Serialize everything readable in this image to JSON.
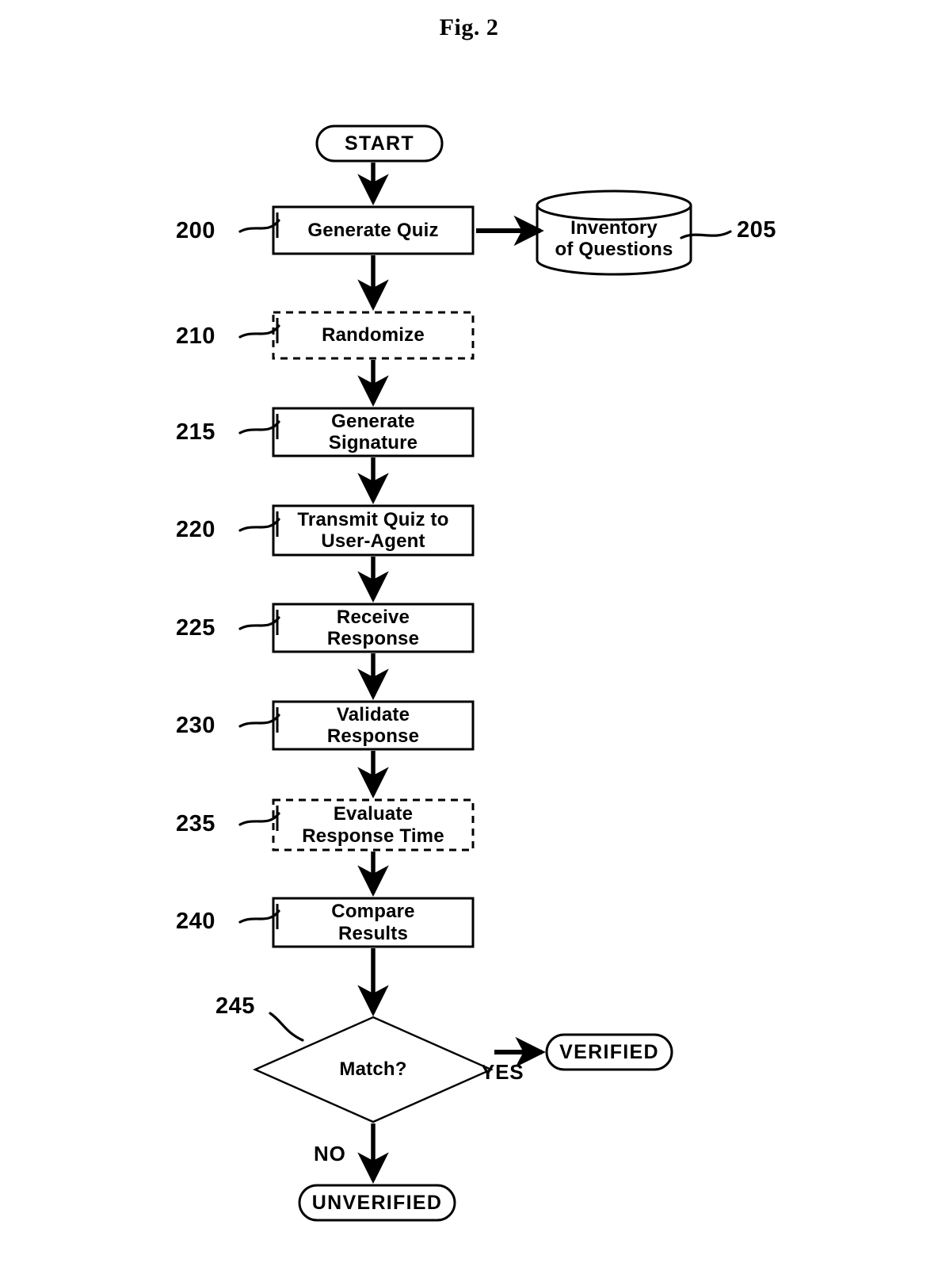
{
  "figure": {
    "title": "Fig. 2",
    "type": "flowchart",
    "description": "Patent flowchart for quiz-based user-agent verification"
  },
  "nodes": [
    {
      "id": "start",
      "kind": "terminator",
      "label": "START",
      "ref": null,
      "border": "solid"
    },
    {
      "id": "200",
      "kind": "process",
      "label": "Generate Quiz",
      "ref": "200",
      "border": "solid"
    },
    {
      "id": "205",
      "kind": "database",
      "label": "Inventory\nof Questions",
      "ref": "205",
      "border": "solid"
    },
    {
      "id": "210",
      "kind": "process",
      "label": "Randomize",
      "ref": "210",
      "border": "dashed"
    },
    {
      "id": "215",
      "kind": "process",
      "label": "Generate\nSignature",
      "ref": "215",
      "border": "solid"
    },
    {
      "id": "220",
      "kind": "process",
      "label": "Transmit Quiz to\nUser-Agent",
      "ref": "220",
      "border": "solid"
    },
    {
      "id": "225",
      "kind": "process",
      "label": "Receive\nResponse",
      "ref": "225",
      "border": "solid"
    },
    {
      "id": "230",
      "kind": "process",
      "label": "Validate\nResponse",
      "ref": "230",
      "border": "solid"
    },
    {
      "id": "235",
      "kind": "process",
      "label": "Evaluate\nResponse Time",
      "ref": "235",
      "border": "dashed"
    },
    {
      "id": "240",
      "kind": "process",
      "label": "Compare\nResults",
      "ref": "240",
      "border": "solid"
    },
    {
      "id": "245",
      "kind": "decision",
      "label": "Match?",
      "ref": "245",
      "border": "solid"
    },
    {
      "id": "verified",
      "kind": "terminator",
      "label": "VERIFIED",
      "ref": null,
      "border": "solid"
    },
    {
      "id": "unverified",
      "kind": "terminator",
      "label": "UNVERIFIED",
      "ref": null,
      "border": "solid"
    }
  ],
  "edges": [
    {
      "from": "start",
      "to": "200",
      "label": "",
      "direction": "down"
    },
    {
      "from": "200",
      "to": "205",
      "label": "",
      "direction": "right"
    },
    {
      "from": "200",
      "to": "210",
      "label": "",
      "direction": "down"
    },
    {
      "from": "210",
      "to": "215",
      "label": "",
      "direction": "down"
    },
    {
      "from": "215",
      "to": "220",
      "label": "",
      "direction": "down"
    },
    {
      "from": "220",
      "to": "225",
      "label": "",
      "direction": "down"
    },
    {
      "from": "225",
      "to": "230",
      "label": "",
      "direction": "down"
    },
    {
      "from": "230",
      "to": "235",
      "label": "",
      "direction": "down"
    },
    {
      "from": "235",
      "to": "240",
      "label": "",
      "direction": "down"
    },
    {
      "from": "240",
      "to": "245",
      "label": "",
      "direction": "down"
    },
    {
      "from": "245",
      "to": "verified",
      "label": "YES",
      "direction": "right"
    },
    {
      "from": "245",
      "to": "unverified",
      "label": "NO",
      "direction": "down"
    }
  ],
  "labels": {
    "yes": "YES",
    "no": "NO"
  },
  "refs": {
    "r200": "200",
    "r205": "205",
    "r210": "210",
    "r215": "215",
    "r220": "220",
    "r225": "225",
    "r230": "230",
    "r235": "235",
    "r240": "240",
    "r245": "245"
  },
  "text": {
    "start": "START",
    "generate_quiz": "Generate Quiz",
    "inventory": "Inventory\nof Questions",
    "randomize": "Randomize",
    "generate_signature": "Generate\nSignature",
    "transmit": "Transmit Quiz to\nUser-Agent",
    "receive": "Receive\nResponse",
    "validate": "Validate\nResponse",
    "evaluate": "Evaluate\nResponse Time",
    "compare": "Compare\nResults",
    "match": "Match?",
    "verified": "VERIFIED",
    "unverified": "UNVERIFIED"
  },
  "colors": {
    "ink": "#000000",
    "paper": "#ffffff"
  }
}
